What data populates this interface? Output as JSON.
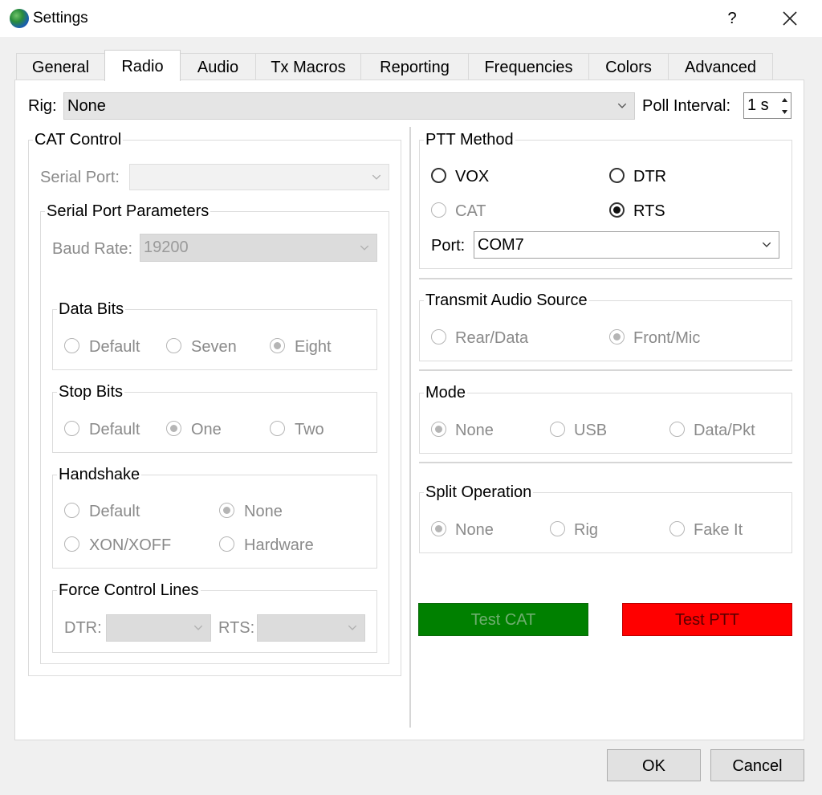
{
  "window": {
    "title": "Settings",
    "help": "?"
  },
  "tabs": [
    "General",
    "Radio",
    "Audio",
    "Tx Macros",
    "Reporting",
    "Frequencies",
    "Colors",
    "Advanced"
  ],
  "rig": {
    "label": "Rig:",
    "value": "None"
  },
  "poll": {
    "label": "Poll Interval:",
    "value": "1 s"
  },
  "cat": {
    "title": "CAT Control",
    "serial_port_label": "Serial Port:",
    "serial_port_value": "",
    "params_title": "Serial Port Parameters",
    "baud_label": "Baud Rate:",
    "baud_value": "19200",
    "data_bits": {
      "title": "Data Bits",
      "options": [
        "Default",
        "Seven",
        "Eight"
      ],
      "selected": "Eight"
    },
    "stop_bits": {
      "title": "Stop Bits",
      "options": [
        "Default",
        "One",
        "Two"
      ],
      "selected": "One"
    },
    "handshake": {
      "title": "Handshake",
      "options": [
        "Default",
        "None",
        "XON/XOFF",
        "Hardware"
      ],
      "selected": "None"
    },
    "force": {
      "title": "Force Control Lines",
      "dtr_label": "DTR:",
      "rts_label": "RTS:",
      "dtr_value": "",
      "rts_value": ""
    }
  },
  "ptt": {
    "title": "PTT Method",
    "options": [
      "VOX",
      "DTR",
      "CAT",
      "RTS"
    ],
    "selected": "RTS",
    "port_label": "Port:",
    "port_value": "COM7"
  },
  "audio_source": {
    "title": "Transmit Audio Source",
    "options": [
      "Rear/Data",
      "Front/Mic"
    ],
    "selected": "Front/Mic"
  },
  "mode": {
    "title": "Mode",
    "options": [
      "None",
      "USB",
      "Data/Pkt"
    ],
    "selected": "None"
  },
  "split": {
    "title": "Split Operation",
    "options": [
      "None",
      "Rig",
      "Fake It"
    ],
    "selected": "None"
  },
  "buttons": {
    "test_cat": "Test CAT",
    "test_ptt": "Test PTT",
    "ok": "OK",
    "cancel": "Cancel"
  },
  "colors": {
    "test_cat_bg": "#008000",
    "test_cat_text": "#6fae6f",
    "test_ptt_bg": "#ff0000",
    "test_ptt_text": "#5a0000"
  },
  "icons": {
    "app": "globe-icon",
    "close": "close-icon",
    "dropdown": "chevron-down-icon",
    "spin_up": "triangle-up-icon",
    "spin_down": "triangle-down-icon"
  }
}
